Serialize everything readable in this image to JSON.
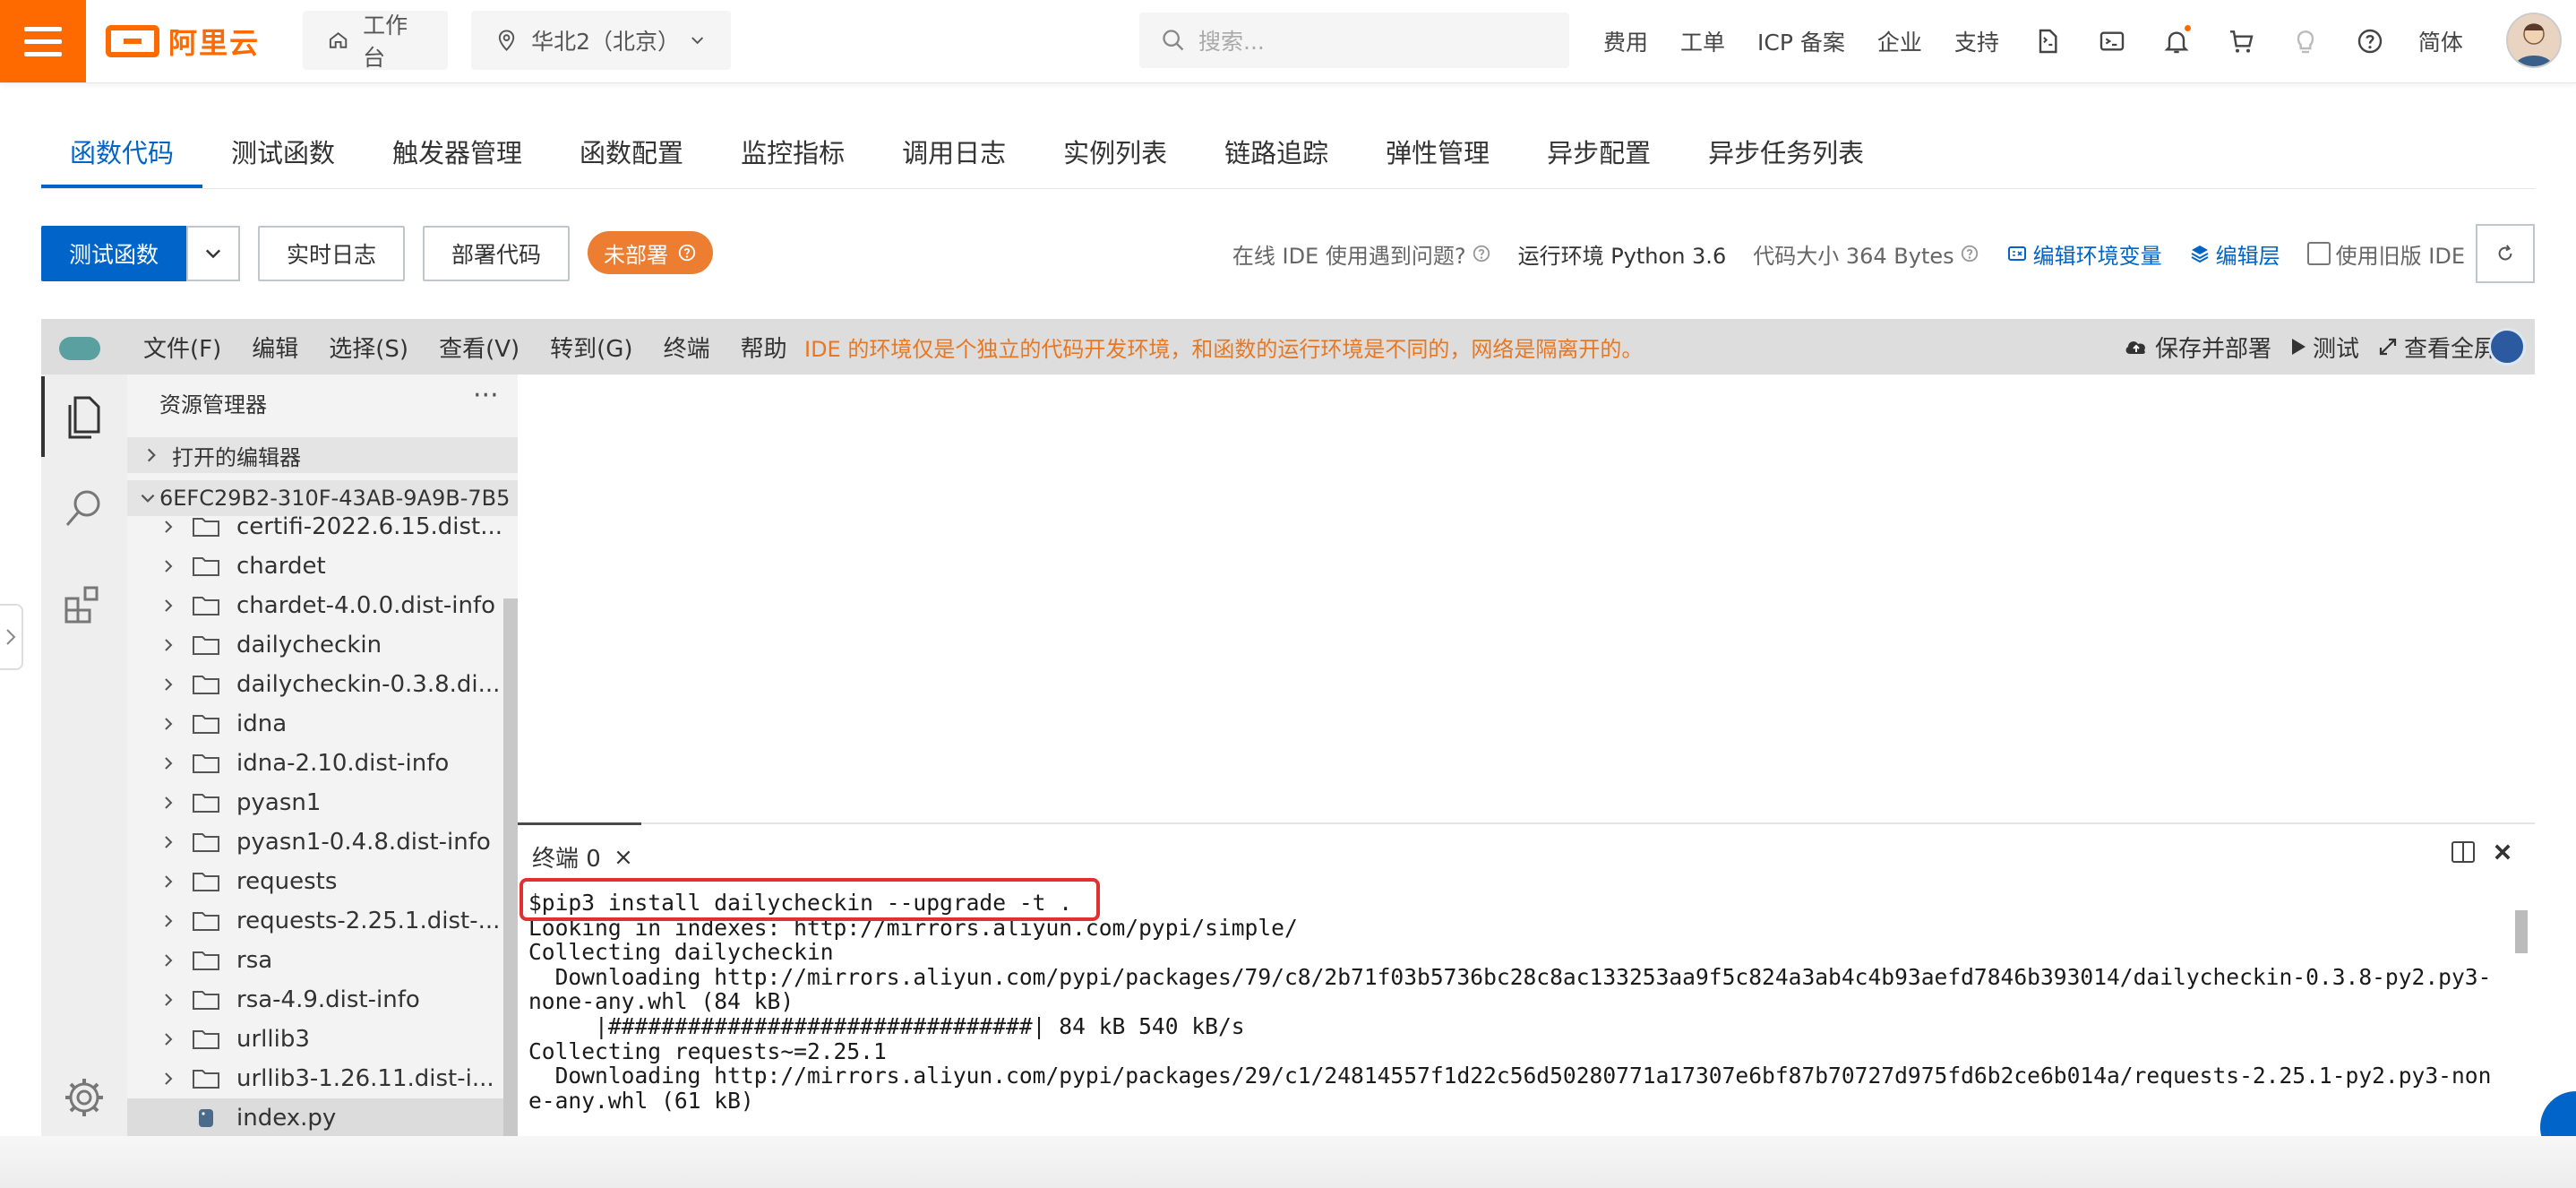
{
  "topbar": {
    "brand": "阿里云",
    "workbench": "工作台",
    "region": "华北2（北京）",
    "search_placeholder": "搜索...",
    "nav": [
      "费用",
      "工单",
      "ICP 备案",
      "企业",
      "支持"
    ],
    "language": "简体",
    "icons": [
      "menu-icon",
      "home-icon",
      "location-icon",
      "chevron-down-icon",
      "search-icon",
      "api-icon",
      "terminal-icon",
      "bell-icon",
      "cart-icon",
      "lightbulb-icon",
      "help-icon"
    ]
  },
  "tabs": [
    "函数代码",
    "测试函数",
    "触发器管理",
    "函数配置",
    "监控指标",
    "调用日志",
    "实例列表",
    "链路追踪",
    "弹性管理",
    "异步配置",
    "异步任务列表"
  ],
  "active_tab": "函数代码",
  "toolbar": {
    "test_button": "测试函数",
    "log_button": "实时日志",
    "deploy_button": "部署代码",
    "status_badge": "未部署",
    "ide_issue": "在线 IDE 使用遇到问题?",
    "runtime": "运行环境 Python 3.6",
    "code_size": "代码大小 364 Bytes",
    "edit_env": "编辑环境变量",
    "edit_layer": "编辑层",
    "legacy_ide": "使用旧版 IDE"
  },
  "ide": {
    "menus": [
      "文件(F)",
      "编辑",
      "选择(S)",
      "查看(V)",
      "转到(G)",
      "终端",
      "帮助"
    ],
    "notice": "IDE 的环境仅是个独立的代码开发环境，和函数的运行环境是不同的，网络是隔离开的。",
    "actions": {
      "save_deploy": "保存并部署",
      "test": "测试",
      "fullscreen": "查看全屏"
    },
    "explorer": {
      "title": "资源管理器",
      "more": "···",
      "open_editors": "打开的编辑器",
      "root": "6EFC29B2-310F-43AB-9A9B-7B5",
      "items": [
        {
          "name": "certifi-2022.6.15.dist...",
          "type": "folder"
        },
        {
          "name": "chardet",
          "type": "folder"
        },
        {
          "name": "chardet-4.0.0.dist-info",
          "type": "folder"
        },
        {
          "name": "dailycheckin",
          "type": "folder"
        },
        {
          "name": "dailycheckin-0.3.8.di...",
          "type": "folder"
        },
        {
          "name": "idna",
          "type": "folder"
        },
        {
          "name": "idna-2.10.dist-info",
          "type": "folder"
        },
        {
          "name": "pyasn1",
          "type": "folder"
        },
        {
          "name": "pyasn1-0.4.8.dist-info",
          "type": "folder"
        },
        {
          "name": "requests",
          "type": "folder"
        },
        {
          "name": "requests-2.25.1.dist-...",
          "type": "folder"
        },
        {
          "name": "rsa",
          "type": "folder"
        },
        {
          "name": "rsa-4.9.dist-info",
          "type": "folder"
        },
        {
          "name": "urllib3",
          "type": "folder"
        },
        {
          "name": "urllib3-1.26.11.dist-i...",
          "type": "folder"
        },
        {
          "name": "index.py",
          "type": "file"
        }
      ]
    },
    "terminal": {
      "tab_label": "终端 0",
      "lines": [
        "$pip3 install dailycheckin --upgrade -t .",
        "Looking in indexes: http://mirrors.aliyun.com/pypi/simple/",
        "Collecting dailycheckin",
        "  Downloading http://mirrors.aliyun.com/pypi/packages/79/c8/2b71f03b5736bc28c8ac133253aa9f5c824a3ab4c4b93aefd7846b393014/dailycheckin-0.3.8-py2.py3-",
        "none-any.whl (84 kB)",
        "     |################################| 84 kB 540 kB/s",
        "Collecting requests~=2.25.1",
        "  Downloading http://mirrors.aliyun.com/pypi/packages/29/c1/24814557f1d22c56d50280771a17307e6bf87b70727d975fd6b2ce6b014a/requests-2.25.1-py2.py3-non",
        "e-any.whl (61 kB)"
      ]
    }
  },
  "colors": {
    "accent": "#0064c8",
    "brand": "#ff6a00",
    "badge": "#ed7d31",
    "notice": "#e87722",
    "highlight": "#e03030"
  }
}
